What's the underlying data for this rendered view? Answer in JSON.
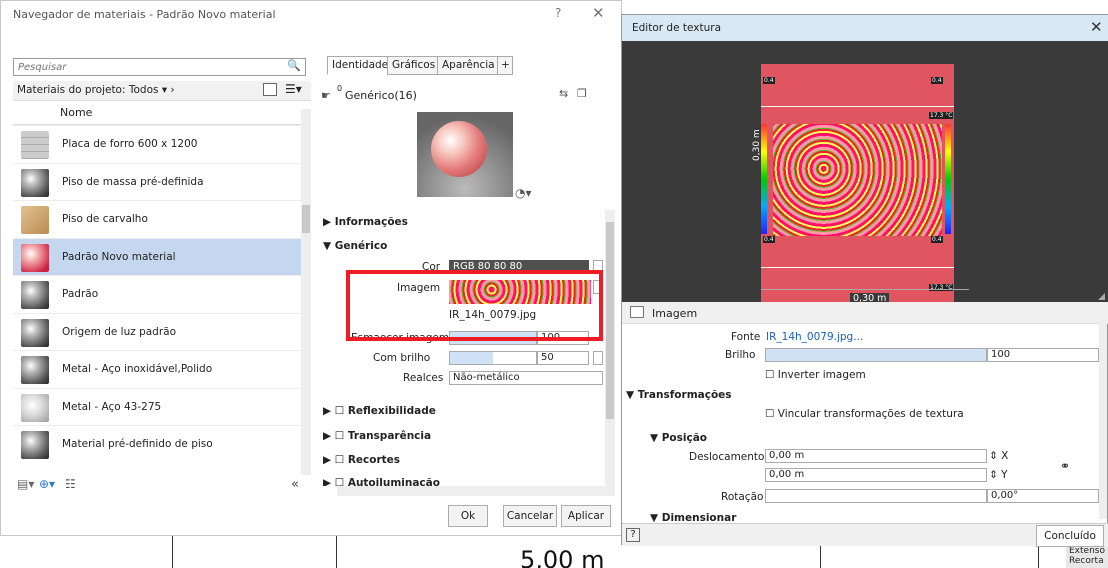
{
  "material_browser": {
    "title": "Navegador de materiais - Padrão Novo material",
    "help": "?",
    "close": "✕",
    "search_placeholder": "Pesquisar",
    "project_filter": "Materiais do projeto: Todos",
    "column_header": "Nome",
    "items": [
      {
        "label": "Placa de forro 600 x 1200",
        "thumb": "grid",
        "selected": false
      },
      {
        "label": "Piso de massa pré-definida",
        "thumb": "sphere",
        "selected": false
      },
      {
        "label": "Piso de carvalho",
        "thumb": "wood",
        "selected": false
      },
      {
        "label": "Padrão Novo material",
        "thumb": "pinksph",
        "selected": true
      },
      {
        "label": "Padrão",
        "thumb": "sphere",
        "selected": false
      },
      {
        "label": "Origem de luz padrão",
        "thumb": "sphere",
        "selected": false
      },
      {
        "label": "Metal - Aço inoxidável,Polido",
        "thumb": "sphere",
        "selected": false
      },
      {
        "label": "Metal - Aço 43-275",
        "thumb": "marble",
        "selected": false
      },
      {
        "label": "Material pré-definido de piso",
        "thumb": "sphere",
        "selected": false
      }
    ],
    "collapse_label": "«"
  },
  "editor": {
    "tabs": [
      "Identidade",
      "Gráficos",
      "Aparência"
    ],
    "add_tab": "+",
    "asset_count": "0",
    "asset_name": "Genérico(16)",
    "sections": {
      "info": "Informações",
      "generic": "Genérico",
      "reflect": "Reflexibilidade",
      "transp": "Transparência",
      "cutouts": "Recortes",
      "selfillum": "Autoiluminação"
    },
    "cor_label": "Cor",
    "cor_value": "RGB 80 80 80",
    "imagem_label": "Imagem",
    "imagem_file": "IR_14h_0079.jpg",
    "fade_label": "Esmaecer imagem",
    "fade_value": "100",
    "gloss_label": "Com brilho",
    "gloss_value": "50",
    "highlights_label": "Realces",
    "highlights_value": "Não-metálico",
    "ok": "Ok",
    "cancel": "Cancelar",
    "apply": "Aplicar"
  },
  "texture_editor": {
    "title": "Editor de textura",
    "close": "✕",
    "dim_vertical": "0,30 m",
    "dim_horizontal": "0,30 m",
    "tag_a": "0.4",
    "tag_b": "17.3 °C",
    "imagem_section": "Imagem",
    "fonte_label": "Fonte",
    "fonte_value": "IR_14h_0079.jpg...",
    "brilho_label": "Brilho",
    "brilho_value": "100",
    "invert_label": "Inverter imagem",
    "transform_section": "Transformações",
    "link_label": "Vincular transformações de textura",
    "pos_section": "Posição",
    "offset_label": "Deslocamento",
    "offset_x": "0,00 m",
    "offset_y": "0,00 m",
    "axis_x": "X",
    "axis_y": "Y",
    "rotation_label": "Rotação",
    "rotation_value": "0,00°",
    "scale_section": "Dimensionar",
    "help": "?",
    "done": "Concluído"
  },
  "background": {
    "dimension": "5,00 m",
    "ext_a": "Extensõ",
    "ext_b": "Recorta"
  }
}
